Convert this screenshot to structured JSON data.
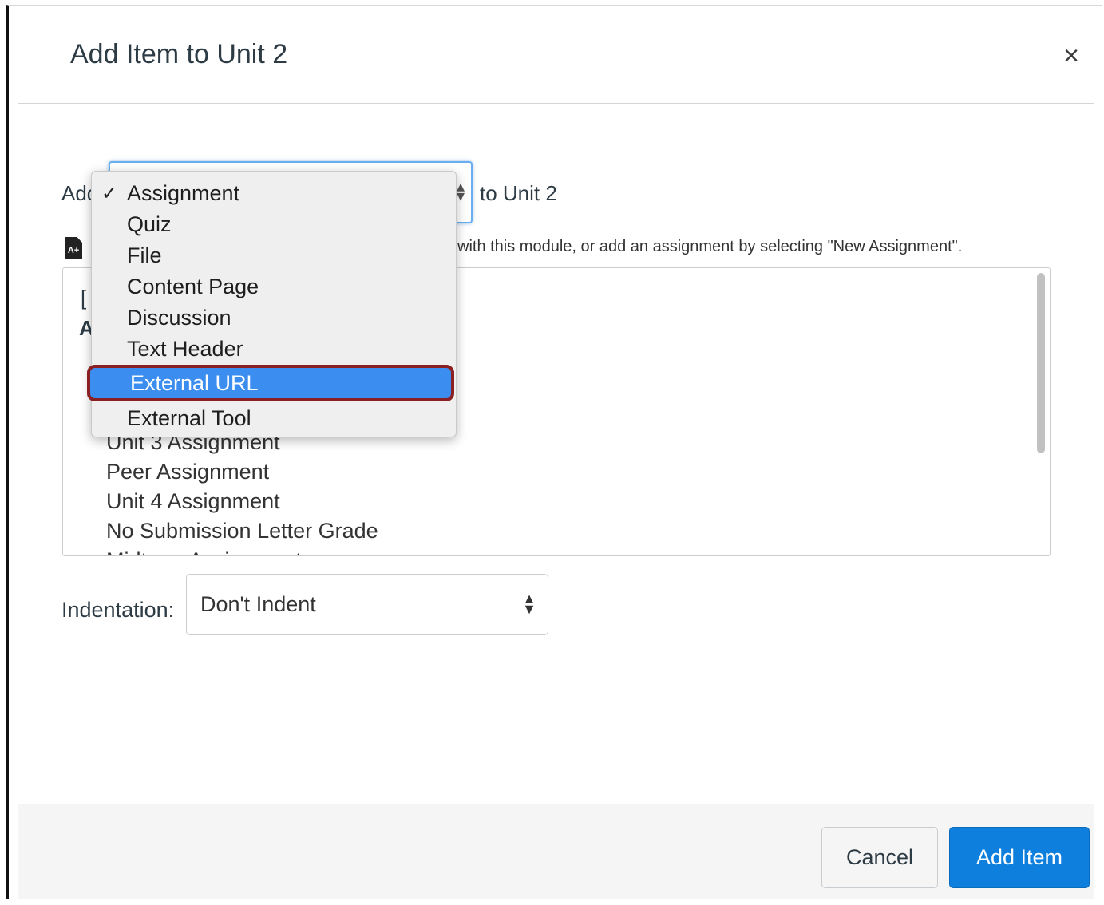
{
  "dialog": {
    "title": "Add Item to Unit 2",
    "close_glyph": "×"
  },
  "add_row": {
    "prefix": "Add",
    "suffix": "to Unit 2",
    "dropdown_options": [
      {
        "label": "Assignment",
        "checked": true
      },
      {
        "label": "Quiz"
      },
      {
        "label": "File"
      },
      {
        "label": "Content Page"
      },
      {
        "label": "Discussion"
      },
      {
        "label": "Text Header"
      },
      {
        "label": "External URL",
        "highlighted": true
      },
      {
        "label": "External Tool"
      }
    ]
  },
  "help": {
    "icon": "assignment-icon",
    "text": "with this module, or add an assignment by selecting \"New Assignment\"."
  },
  "listbox": {
    "items": [
      "Unit 3 Assignment",
      "Peer Assignment",
      "Unit 4 Assignment",
      "No Submission Letter Grade",
      "Midterm Assignment"
    ]
  },
  "indentation": {
    "label": "Indentation:",
    "value": "Don't Indent"
  },
  "footer": {
    "cancel_label": "Cancel",
    "add_label": "Add Item"
  },
  "colors": {
    "primary_button": "#0e7fdc",
    "highlight_option": "#3b8df0",
    "highlight_outline": "#8a1f24"
  }
}
